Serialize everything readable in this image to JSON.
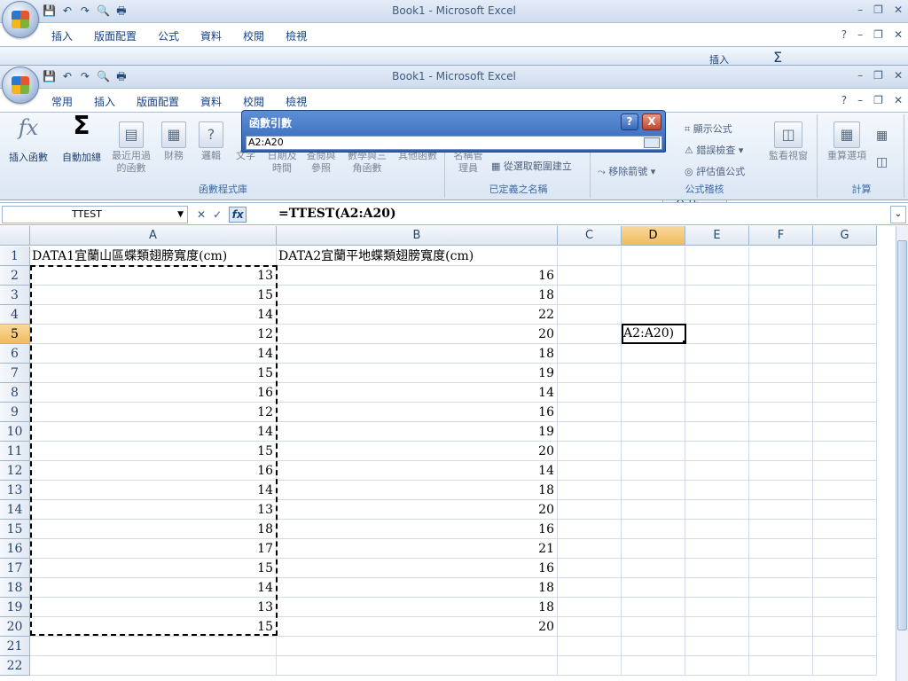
{
  "window": {
    "title": "Book1 - Microsoft Excel",
    "back_title": "Book1 - Microsoft Excel"
  },
  "tabs": [
    "常用",
    "插入",
    "版面配置",
    "公式",
    "資料",
    "校閱",
    "檢視"
  ],
  "active_tab": "公式",
  "ribbon": {
    "insert_function": "插入函數",
    "autosum": "自動加總",
    "recent": "最近用過的函數",
    "financial": "財務",
    "logical": "邏輯",
    "text": "文字",
    "datetime": "日期及時間",
    "lookup": "查閱與參照",
    "math": "數學與三角函數",
    "other": "其他函數",
    "group_library": "函數程式庫",
    "name_manager": "名稱管理員",
    "create_from_selection": "從選取範圍建立",
    "group_names": "已定義之名稱",
    "show_formulas": "顯示公式",
    "error_check": "錯誤檢查",
    "remove_arrows": "移除箭號",
    "evaluate": "評估值公式",
    "watch_window": "監看視窗",
    "group_audit": "公式稽核",
    "calc_options": "重算選項",
    "group_calc": "計算",
    "back_insert": "插入"
  },
  "dialog": {
    "title": "函數引數",
    "input": "A2:A20",
    "help": "?",
    "close": "X"
  },
  "formula_bar": {
    "name_box": "TTEST",
    "formula": "=TTEST(A2:A20)"
  },
  "columns": [
    "A",
    "B",
    "C",
    "D",
    "E",
    "F",
    "G"
  ],
  "rows": [
    "1",
    "2",
    "3",
    "4",
    "5",
    "6",
    "7",
    "8",
    "9",
    "10",
    "11",
    "12",
    "13",
    "14",
    "15",
    "16",
    "17",
    "18",
    "19",
    "20",
    "21",
    "22"
  ],
  "headers": {
    "a1": "DATA1宜蘭山區蝶類翅膀寬度(cm)",
    "b1": "DATA2宜蘭平地蝶類翅膀寬度(cm)"
  },
  "col_a": [
    "13",
    "15",
    "14",
    "12",
    "14",
    "15",
    "16",
    "12",
    "14",
    "15",
    "16",
    "14",
    "13",
    "18",
    "17",
    "15",
    "14",
    "13",
    "15"
  ],
  "col_b": [
    "16",
    "18",
    "22",
    "20",
    "18",
    "19",
    "14",
    "16",
    "19",
    "20",
    "14",
    "18",
    "20",
    "16",
    "21",
    "16",
    "18",
    "18",
    "20"
  ],
  "active_cell": {
    "text": "A2:A20)"
  }
}
